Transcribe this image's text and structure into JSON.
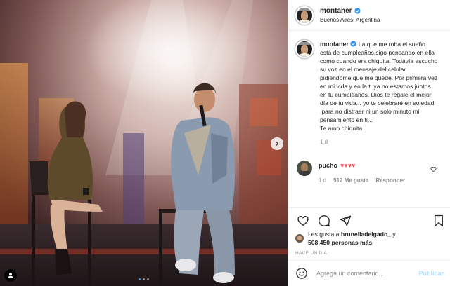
{
  "header": {
    "username": "montaner",
    "location": "Buenos Aires, Argentina"
  },
  "caption": {
    "username": "montaner",
    "text": "La que me roba el sueño está de cumpleaños,sigo pensando en ella como cuando era chiquita. Todavía escucho su voz en el mensaje del celular pidiéndome que me quede. Por primera vez en mi vida y en la tuya no estamos juntos en tu cumpleaños. Dios te regale el mejor día de tu vida... yo te celebraré en soledad ,para no distraer ni un solo minuto mi pensamiento en ti...",
    "closing": "Te amo chiquita",
    "age": "1 d"
  },
  "comment": {
    "username": "pucho",
    "text": "♥♥♥♥",
    "age": "1 d",
    "likes": "512 Me gusta",
    "reply_label": "Responder"
  },
  "likes": {
    "prefix": "Les gusta a",
    "user": "brunelladelgado_",
    "joiner": "y",
    "count": "508,450 personas más"
  },
  "timestamp": "HACE UN DÍA",
  "add_comment": {
    "placeholder": "Agrega un comentario...",
    "post_label": "Publicar"
  },
  "carousel": {
    "slide": 1,
    "total": 3
  },
  "colors": {
    "verified": "#3897f0",
    "heart": "#ed4956",
    "muted": "#8e8e8e",
    "post_disabled": "#b2dffc"
  },
  "icons": [
    "verified-icon",
    "heart-icon",
    "comment-icon",
    "share-icon",
    "bookmark-icon",
    "emoji-icon",
    "chevron-right-icon",
    "user-tag-icon"
  ]
}
